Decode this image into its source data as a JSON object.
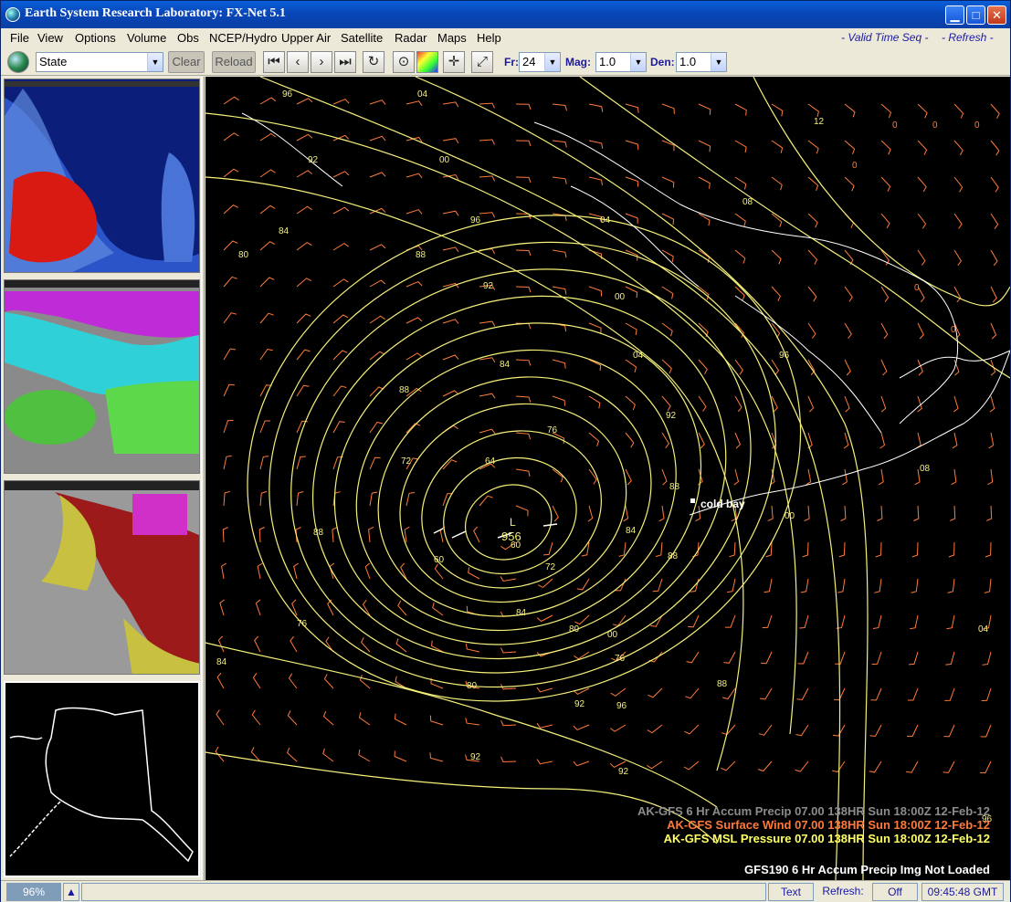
{
  "window": {
    "title": "Earth System Research Laboratory: FX-Net 5.1",
    "minimize_glyph": "▁",
    "maximize_glyph": "□",
    "close_glyph": "✕"
  },
  "menu": {
    "items": [
      "File",
      "View",
      "Options",
      "Volume",
      "Obs",
      "NCEP/Hydro",
      "Upper Air",
      "Satellite",
      "Radar",
      "Maps",
      "Help"
    ],
    "valid_time_seq": "- Valid Time Seq -",
    "refresh": "- Refresh -"
  },
  "toolbar": {
    "scale_select": "State",
    "clear_label": "Clear",
    "reload_label": "Reload",
    "fr_label": "Fr:",
    "fr_value": "24",
    "mag_label": "Mag:",
    "mag_value": "1.0",
    "den_label": "Den:",
    "den_value": "1.0",
    "icons": [
      "globe-icon",
      "first-frame-icon",
      "prev-frame-icon",
      "next-frame-icon",
      "last-frame-icon",
      "loop-icon",
      "stop-icon",
      "color-table-icon",
      "crosshair-icon",
      "zoom-icon"
    ]
  },
  "map": {
    "station_label": "cold bay",
    "low_center_value": "956",
    "low_marker": "L",
    "contour_labels": [
      "96",
      "04",
      "12",
      "92",
      "00",
      "08",
      "96",
      "04",
      "84",
      "80",
      "88",
      "92",
      "00",
      "96",
      "04",
      "84",
      "88",
      "92",
      "76",
      "72",
      "64",
      "88",
      "00",
      "76",
      "60",
      "72",
      "84",
      "84",
      "88",
      "60",
      "80",
      "76",
      "96",
      "80",
      "88",
      "92",
      "84",
      "88",
      "92",
      "92",
      "96",
      "08",
      "04",
      "00",
      "0",
      "0",
      "0",
      "0",
      "0",
      "0"
    ],
    "legend": [
      {
        "text": "AK-GFS 6 Hr Accum Precip  07.00 138HR Sun 18:00Z 12-Feb-12",
        "color": "#8c8c8c"
      },
      {
        "text": "AK-GFS Surface Wind  07.00 138HR Sun 18:00Z 12-Feb-12",
        "color": "#ff7a3a"
      },
      {
        "text": "AK-GFS MSL Pressure  07.00 138HR Sun 18:00Z 12-Feb-12",
        "color": "#ffff66"
      }
    ],
    "not_loaded": "GFS190 6 Hr Accum Precip Img Not Loaded"
  },
  "status": {
    "zoom": "96%",
    "text_label": "Text",
    "refresh_label": "Refresh:",
    "refresh_value": "Off",
    "clock": "09:45:48 GMT"
  },
  "colors": {
    "contour": "#f5f07a",
    "barb": "#ff7a3a",
    "coast": "#ffffff"
  }
}
